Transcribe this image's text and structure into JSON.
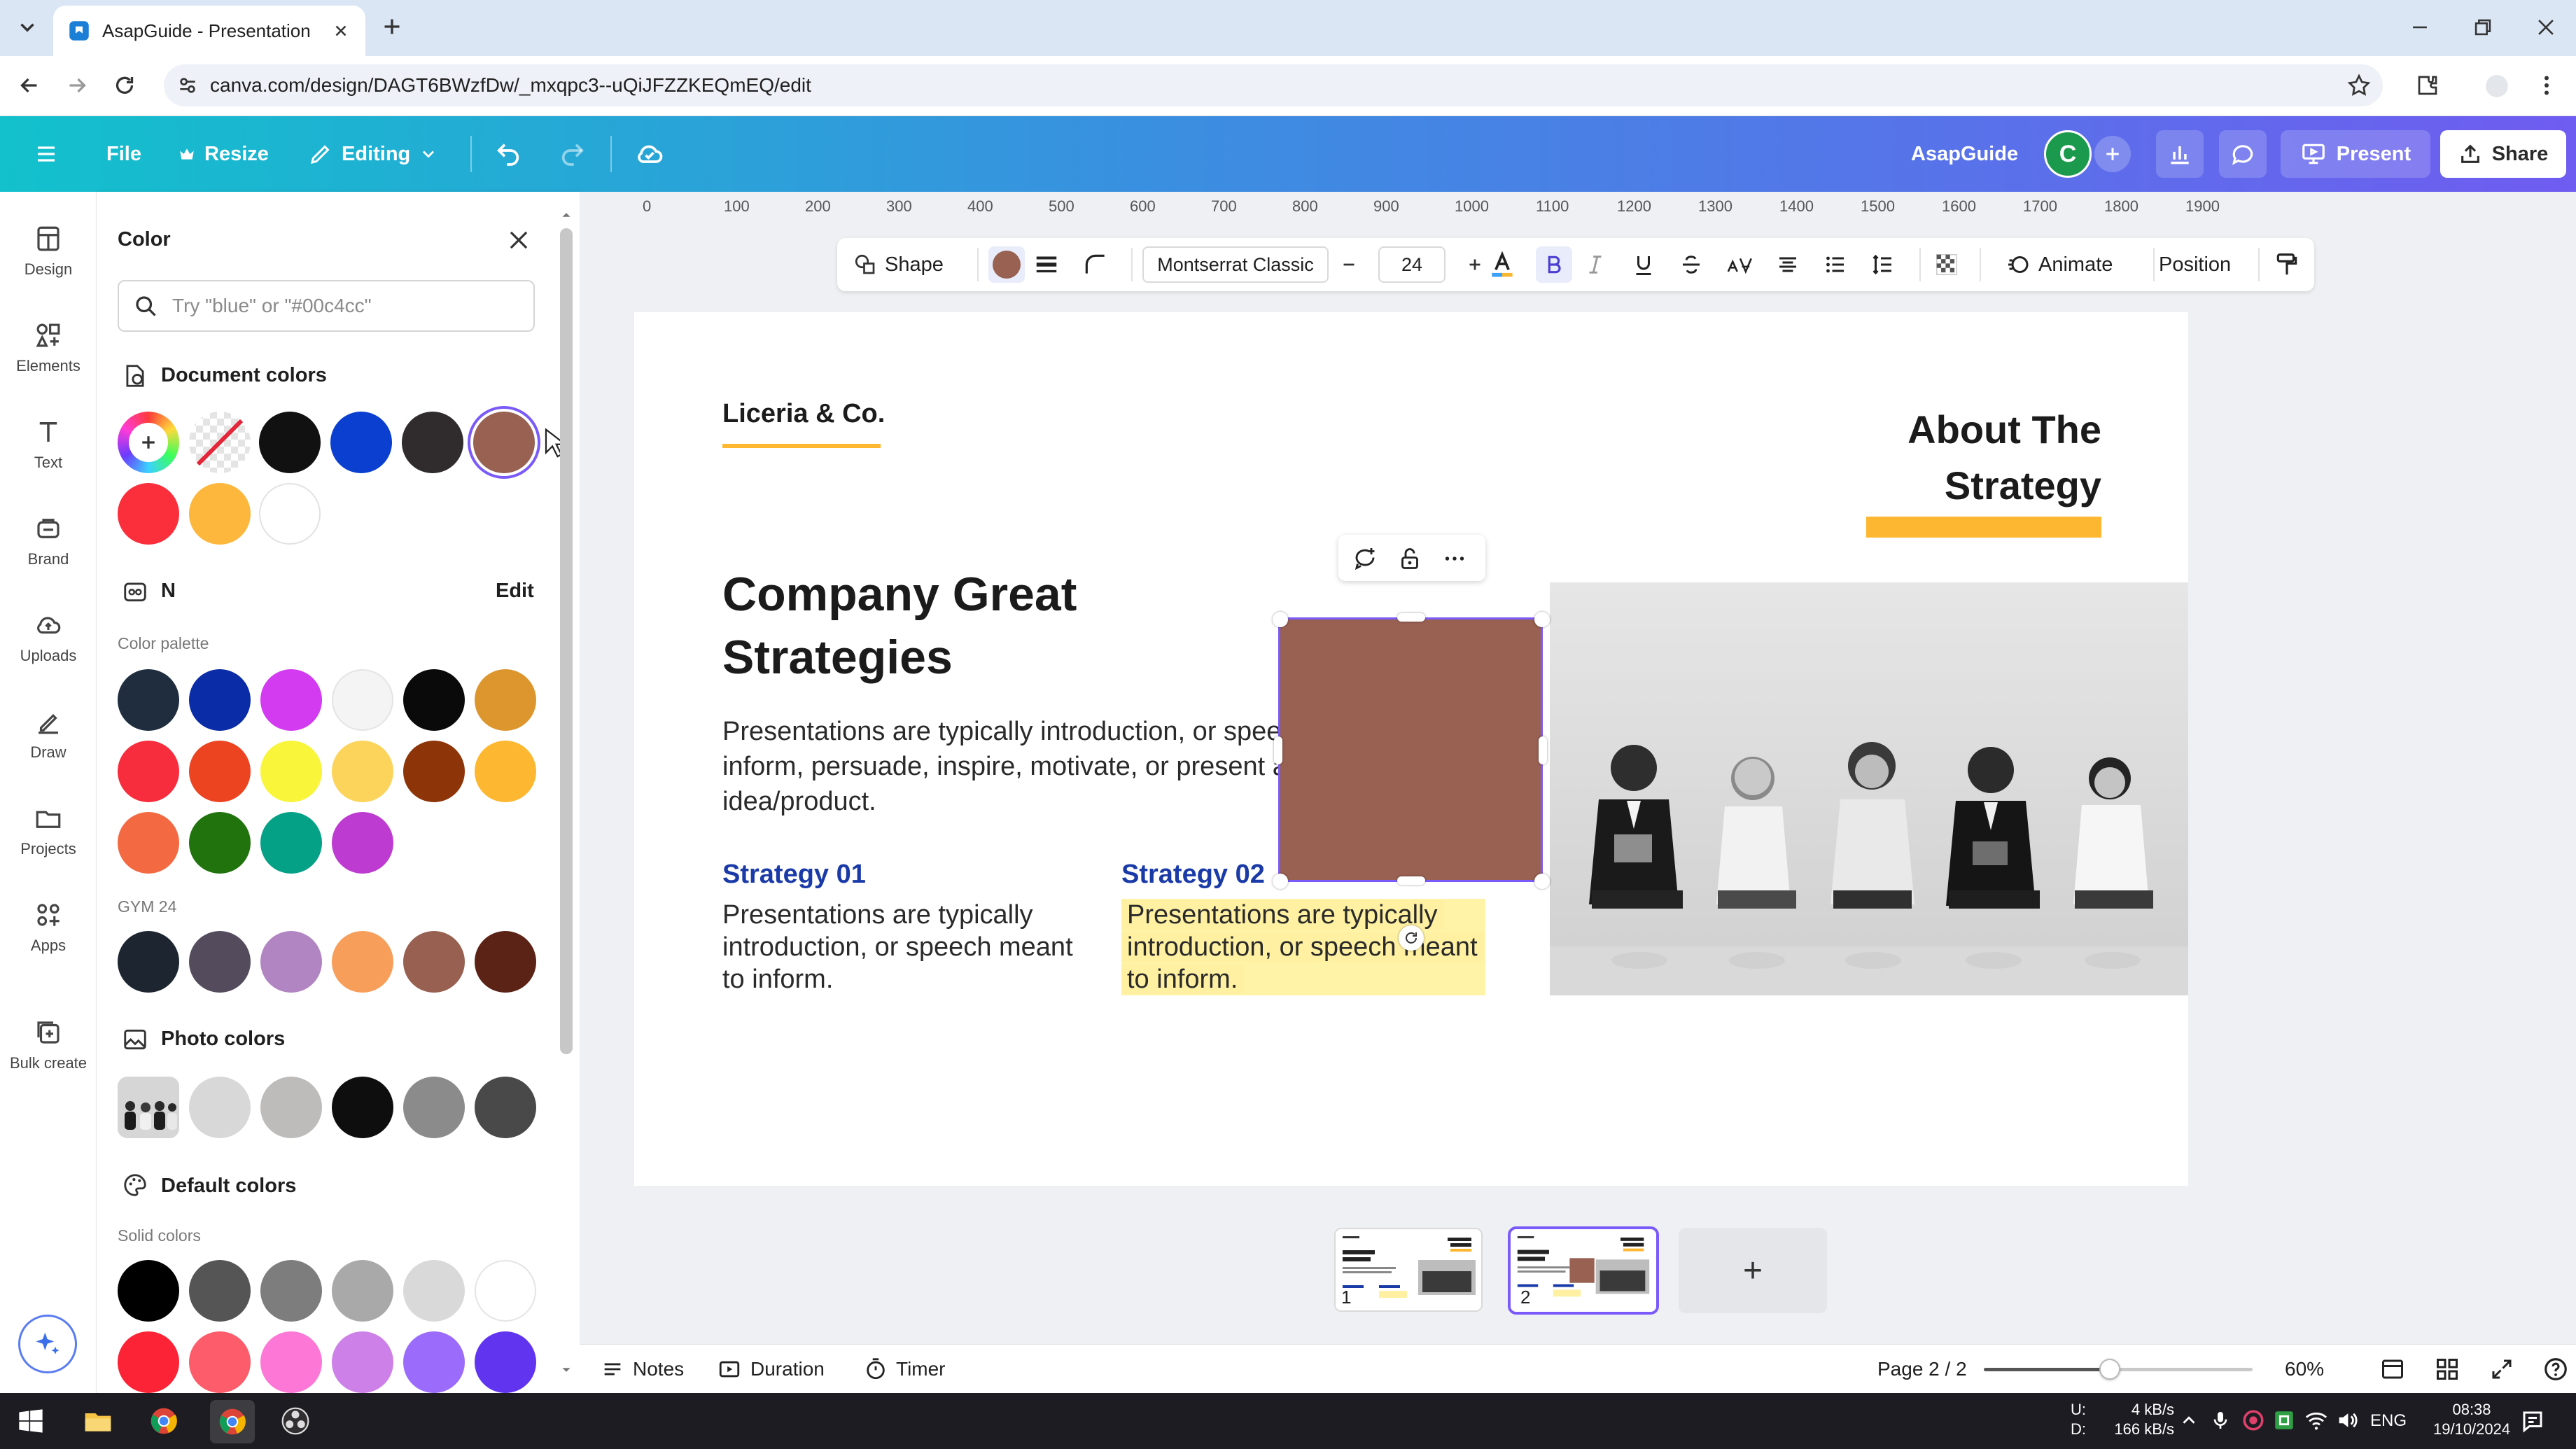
{
  "browser": {
    "tab_title": "AsapGuide - Presentation",
    "url": "canva.com/design/DAGT6BWzfDw/_mxqpc3--uQiJFZZKEQmEQ/edit"
  },
  "header": {
    "file": "File",
    "resize": "Resize",
    "editing": "Editing",
    "team_name": "AsapGuide",
    "avatar_letter": "C",
    "present": "Present",
    "share": "Share"
  },
  "rail": {
    "items": [
      {
        "label": "Design",
        "icon": "design-icon"
      },
      {
        "label": "Elements",
        "icon": "elements-icon"
      },
      {
        "label": "Text",
        "icon": "text-icon"
      },
      {
        "label": "Brand",
        "icon": "brand-icon"
      },
      {
        "label": "Uploads",
        "icon": "uploads-icon"
      },
      {
        "label": "Draw",
        "icon": "draw-icon"
      },
      {
        "label": "Projects",
        "icon": "projects-icon"
      },
      {
        "label": "Apps",
        "icon": "apps-icon"
      },
      {
        "label": "Bulk create",
        "icon": "bulk-create-icon"
      }
    ]
  },
  "color_panel": {
    "title": "Color",
    "search_placeholder": "Try \"blue\" or \"#00c4cc\"",
    "document_colors_title": "Document colors",
    "document_colors": [
      "#111111",
      "#0a3fd0",
      "#302c2e",
      "#986152",
      "#fb2f3c",
      "#fdb73c",
      "#ffffff"
    ],
    "brand_kit_name": "N",
    "edit_label": "Edit",
    "palette_label": "Color palette",
    "palette": [
      "#1f2d3f",
      "#0a2ca6",
      "#d23bf0",
      "#f4f4f4",
      "#0a0a0a",
      "#dd962d",
      "#f72c3c",
      "#ec4321",
      "#f8f53a",
      "#fdd45b",
      "#8d3408",
      "#fdb730",
      "#f36a42",
      "#20730d",
      "#04a186",
      "#be3bd1"
    ],
    "gym_label": "GYM 24",
    "gym_colors": [
      "#1d2630",
      "#544c5d",
      "#b184c2",
      "#f89e5b",
      "#976050",
      "#5b2216"
    ],
    "photo_colors_title": "Photo colors",
    "photo_colors": [
      "#d8d8d8",
      "#bebcba",
      "#0e0e0e",
      "#8b8b8b",
      "#494949"
    ],
    "default_colors_title": "Default colors",
    "solid_label": "Solid colors",
    "solid_row1": [
      "#000000",
      "#555555",
      "#7d7d7d",
      "#a9a9a9",
      "#d9d9d9",
      "#ffffff"
    ],
    "solid_row2": [
      "#fb2335",
      "#fd5c6a",
      "#fd77d6",
      "#cd80e8",
      "#9b6cfb",
      "#6135f0"
    ]
  },
  "toolbar": {
    "shape": "Shape",
    "fill_color": "#986152",
    "font": "Montserrat Classic",
    "font_size": "24",
    "animate": "Animate",
    "position": "Position"
  },
  "ruler": [
    "0",
    "100",
    "200",
    "300",
    "400",
    "500",
    "600",
    "700",
    "800",
    "900",
    "1000",
    "1100",
    "1200",
    "1300",
    "1400",
    "1500",
    "1600",
    "1700",
    "1800",
    "1900"
  ],
  "slide": {
    "brand": "Liceria & Co.",
    "about_line1": "About The",
    "about_line2": "Strategy",
    "title_line1": "Company Great",
    "title_line2": "Strategies",
    "intro": "Presentations are typically introduction, or speech meant to inform, persuade, inspire, motivate, or present a new idea/product.",
    "s1_title": "Strategy 01",
    "s1_body": "Presentations are typically introduction, or speech meant to inform.",
    "s2_title": "Strategy 02",
    "s2_body": "Presentations are typically introduction, or speech meant to inform.",
    "shape_color": "#986152",
    "accent": "#fdb730",
    "strategy_color": "#1a3aa8"
  },
  "pages": {
    "thumbs": [
      {
        "num": "1"
      },
      {
        "num": "2"
      }
    ],
    "add": "+"
  },
  "bottombar": {
    "notes": "Notes",
    "duration": "Duration",
    "timer": "Timer",
    "page": "Page 2 / 2",
    "zoom_percent": 60,
    "zoom": "60%"
  },
  "taskbar": {
    "net_up": "4 kB/s",
    "net_down": "166 kB/s",
    "net_u": "U:",
    "net_d": "D:",
    "lang": "ENG",
    "time": "08:38",
    "date": "19/10/2024"
  }
}
